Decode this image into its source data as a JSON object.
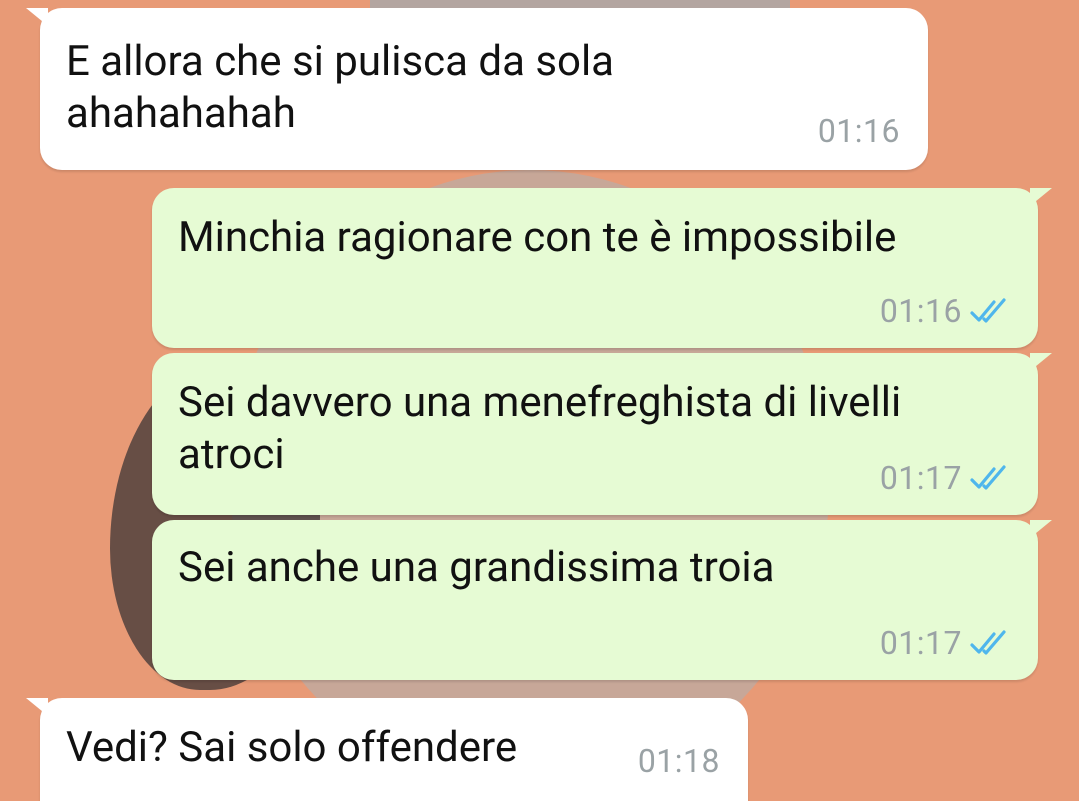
{
  "messages": [
    {
      "direction": "incoming",
      "text": "E allora che si pulisca da sola\nahahahahah",
      "time": "01:16"
    },
    {
      "direction": "outgoing",
      "text": "Minchia ragionare con te è impossibile",
      "time": "01:16",
      "status": "read-double-check"
    },
    {
      "direction": "outgoing",
      "text": "Sei davvero una menefreghista di livelli\natroci",
      "time": "01:17",
      "status": "read-double-check"
    },
    {
      "direction": "outgoing",
      "text": "Sei anche una grandissima troia",
      "time": "01:17",
      "status": "read-double-check"
    },
    {
      "direction": "incoming",
      "text": "Vedi? Sai solo offendere",
      "time": "01:18"
    }
  ],
  "colors": {
    "background": "#e89a76",
    "incoming_bubble": "#ffffff",
    "outgoing_bubble": "#e6fbd4",
    "read_tick": "#4fb6ec",
    "timestamp": "#9aa2a5"
  }
}
